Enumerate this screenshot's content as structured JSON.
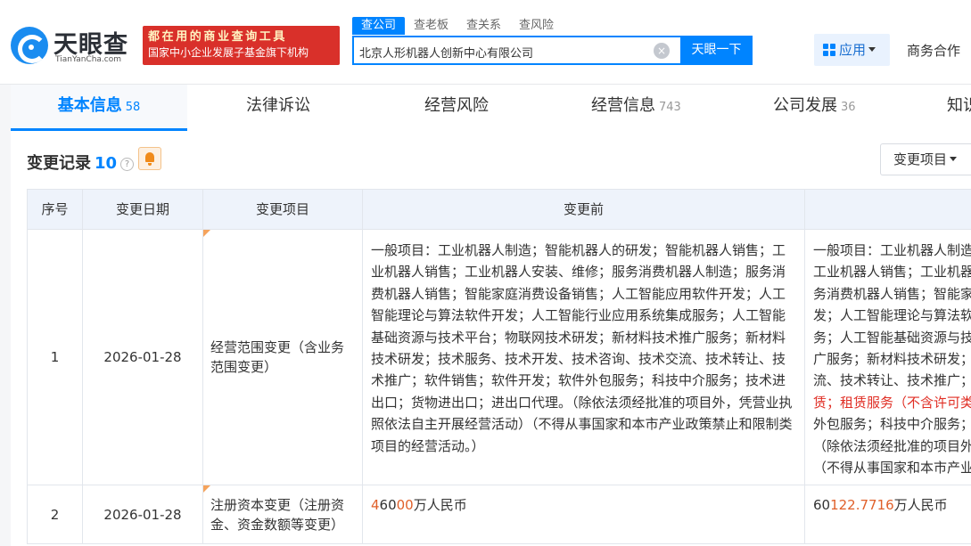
{
  "header": {
    "logo_cn": "天眼查",
    "logo_en": "TianYanCha.com",
    "banner_line1": "都在用的商业查询工具",
    "banner_line2": "国家中小企业发展子基金旗下机构",
    "search_tabs": [
      "查公司",
      "查老板",
      "查关系",
      "查风险"
    ],
    "search_value": "北京人形机器人创新中心有限公司",
    "clear_symbol": "×",
    "search_button": "天眼一下",
    "app_button": "应用",
    "biz_link": "商务合作"
  },
  "nav": {
    "tabs": [
      {
        "label": "基本信息",
        "count": "58"
      },
      {
        "label": "法律诉讼",
        "count": ""
      },
      {
        "label": "经营风险",
        "count": ""
      },
      {
        "label": "经营信息",
        "count": "743"
      },
      {
        "label": "公司发展",
        "count": "36"
      },
      {
        "label": "知识",
        "count": ""
      }
    ]
  },
  "section": {
    "title": "变更记录",
    "count": "10",
    "help": "?",
    "filter_button": "变更项目"
  },
  "table": {
    "headers": [
      "序号",
      "变更日期",
      "变更项目",
      "变更前",
      ""
    ],
    "rows": [
      {
        "no": "1",
        "date": "2026-01-28",
        "item": "经营范围变更（含业务范围变更）",
        "before": "一般项目：工业机器人制造；智能机器人的研发；智能机器人销售；工业机器人销售；工业机器人安装、维修；服务消费机器人制造；服务消费机器人销售；智能家庭消费设备销售；人工智能应用软件开发；人工智能理论与算法软件开发；人工智能行业应用系统集成服务；人工智能基础资源与技术平台；物联网技术研发；新材料技术推广服务；新材料技术研发；技术服务、技术开发、技术咨询、技术交流、技术转让、技术推广；软件销售；软件开发；软件外包服务；科技中介服务；技术进出口；货物进出口；进出口代理。（除依法须经批准的项目外，凭营业执照依法自主开展经营活动）（不得从事国家和本市产业政策禁止和限制类项目的经营活动。）",
        "after_lines": [
          "一般项目：工业机器人制造；智能机器人的研发；智能机器人销售；",
          "工业机器人销售；工业机器人安装、维修；服务消费机器人制造；服",
          "务消费机器人销售；智能家庭消费设备销售；人工智能应用软件开",
          "发；人工智能理论与算法软件开发；人工智能行业应用系统集成服",
          "务；人工智能基础资源与技术平台；物联网技术研发；新材料技术推",
          "广服务；新材料技术研发；技术服务、技术开发、技术咨询、技术交",
          "流、技术转让、技术推广；软件销售；软件开发；",
          "外包服务；科技中介服务；技术进出口；货物进出口；进出口代理。",
          "（除依法须经批准的项目外，凭营业执照依法自主开展经营活动）",
          "（不得从事国家和本市产业政策禁止和限制类项目的经营活动。）"
        ],
        "after_red": "赁；租赁服务（不含许可类租赁服务）"
      },
      {
        "no": "2",
        "date": "2026-01-28",
        "item": "注册资本变更（注册资金、资金数额等变更）",
        "before_parts": [
          "4",
          "60",
          "00",
          "万人民币"
        ],
        "after_parts": [
          "60",
          "122.7716",
          "万人民币"
        ]
      }
    ]
  }
}
